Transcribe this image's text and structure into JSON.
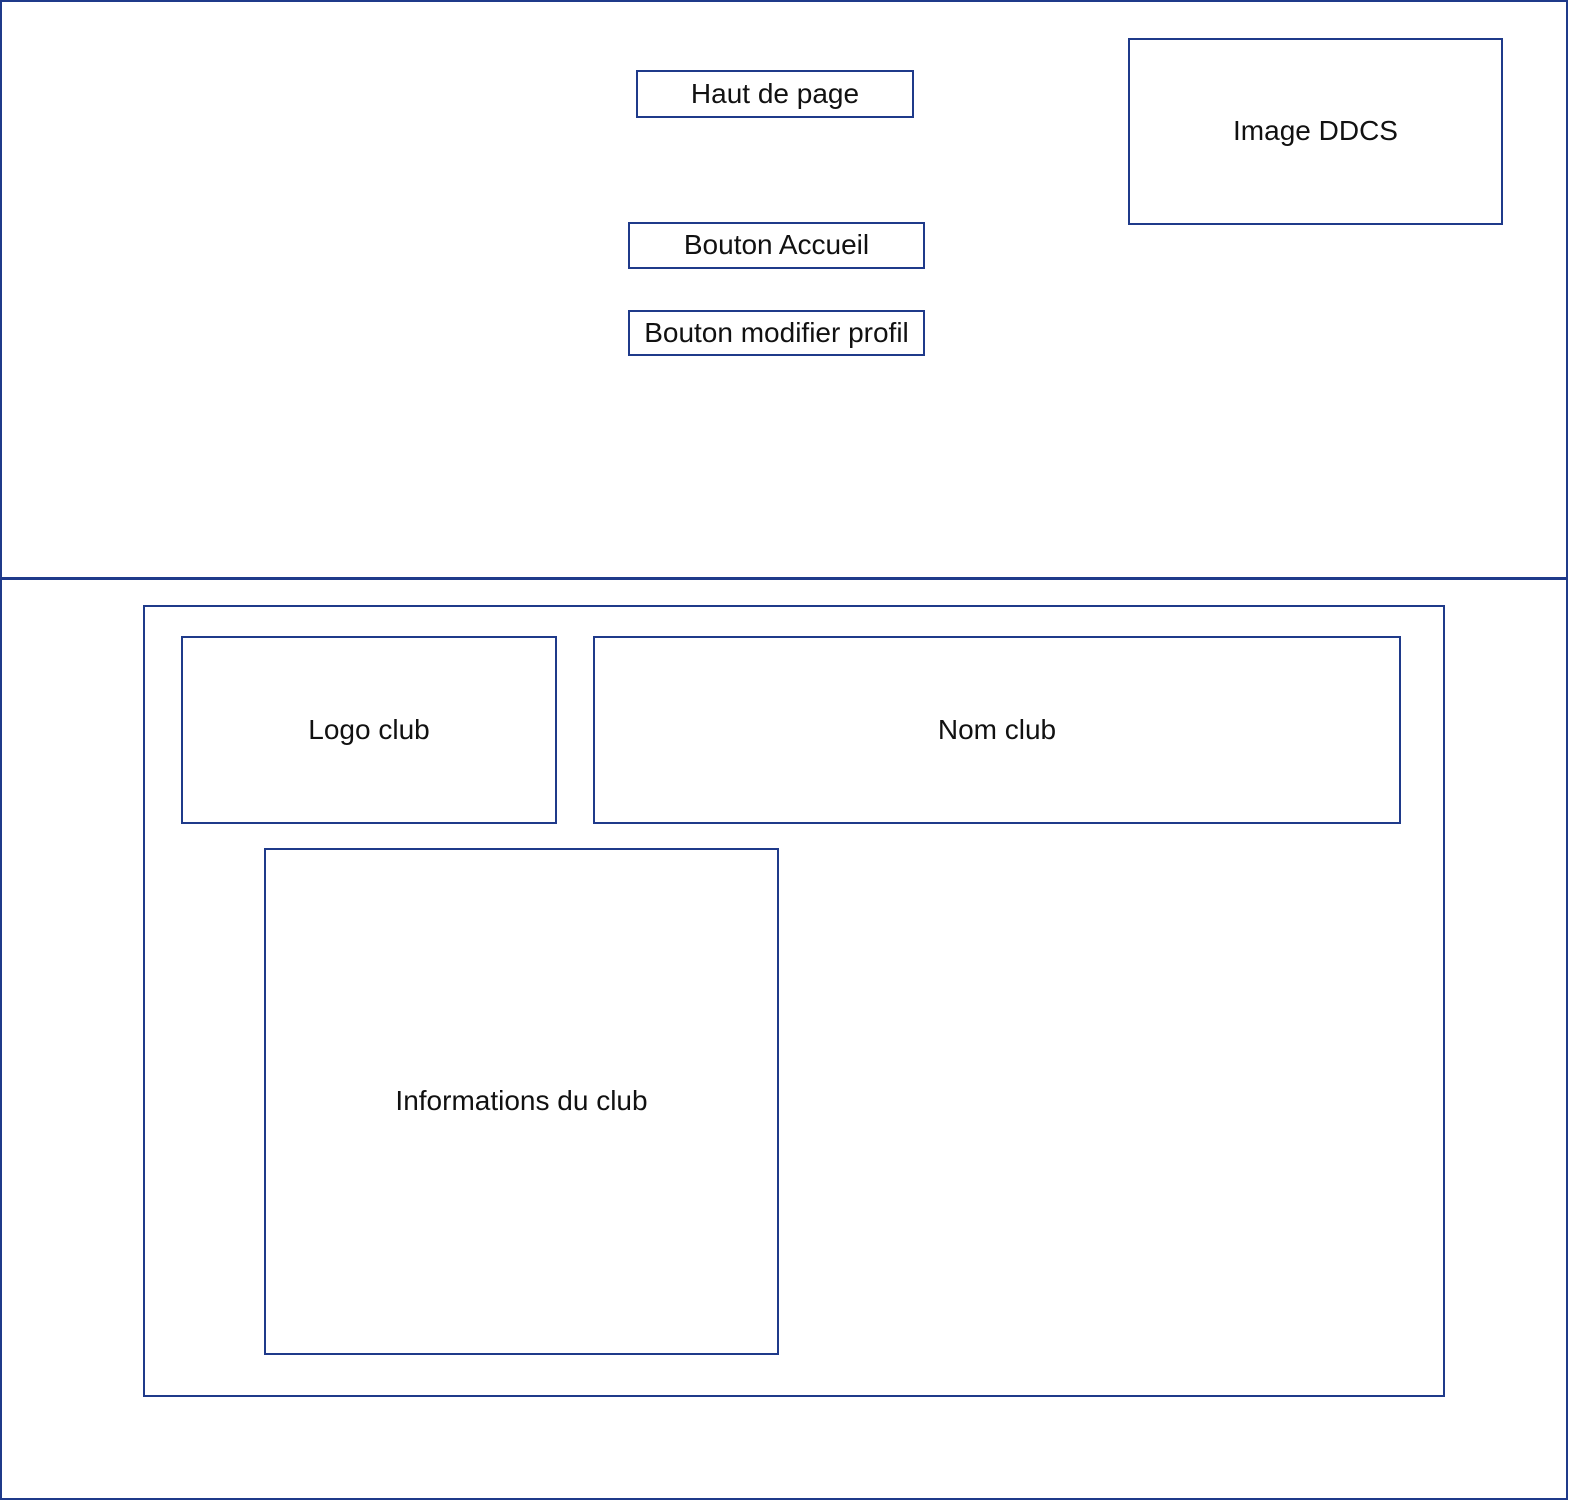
{
  "header": {
    "top_of_page_label": "Haut de page",
    "image_label": "Image DDCS",
    "home_button_label": "Bouton Accueil",
    "edit_profile_button_label": "Bouton modifier profil"
  },
  "content": {
    "logo_label": "Logo club",
    "club_name_label": "Nom club",
    "club_info_label": "Informations du club"
  },
  "colors": {
    "border": "#1f3a8a",
    "background": "#ffffff",
    "text": "#111111"
  }
}
